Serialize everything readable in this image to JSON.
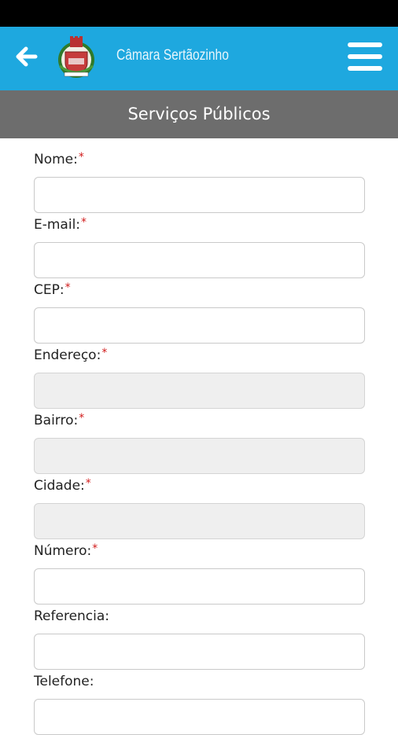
{
  "app": {
    "title": "Câmara Sertãozinho"
  },
  "header": {
    "title": "Serviços Públicos"
  },
  "form": {
    "required_marker": "*",
    "fields": [
      {
        "label": "Nome:",
        "required": true,
        "value": "",
        "readonly": false
      },
      {
        "label": "E-mail:",
        "required": true,
        "value": "",
        "readonly": false
      },
      {
        "label": "CEP:",
        "required": true,
        "value": "",
        "readonly": false
      },
      {
        "label": "Endereço:",
        "required": true,
        "value": "",
        "readonly": true
      },
      {
        "label": "Bairro:",
        "required": true,
        "value": "",
        "readonly": true
      },
      {
        "label": "Cidade:",
        "required": true,
        "value": "",
        "readonly": true
      },
      {
        "label": "Número:",
        "required": true,
        "value": "",
        "readonly": false
      },
      {
        "label": "Referencia:",
        "required": false,
        "value": "",
        "readonly": false
      },
      {
        "label": "Telefone:",
        "required": false,
        "value": "",
        "readonly": false
      }
    ]
  },
  "colors": {
    "app_bar": "#1ea8df",
    "page_header": "#6d6d6d",
    "required": "#d11b1b",
    "readonly_field": "#efefef"
  },
  "icons": {
    "back": "arrow-left-icon",
    "logo": "coat-of-arms-logo",
    "menu": "hamburger-menu-icon"
  }
}
